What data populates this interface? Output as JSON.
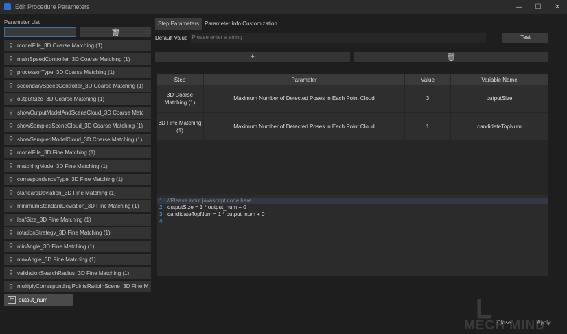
{
  "window": {
    "title": "Edit Procedure Parameters",
    "minimize": "—",
    "maximize": "☐",
    "close": "✕"
  },
  "left": {
    "label": "Parameter List",
    "add": "+",
    "delete": "🗑",
    "items": [
      "modelFile_3D Coarse Matching (1)",
      "mainSpeedController_3D Coarse Matching (1)",
      "processorType_3D Coarse Matching (1)",
      "secondarySpeedController_3D Coarse Matching (1)",
      "outputSize_3D Coarse Matching (1)",
      "showOutputModelAndSceneCloud_3D Coarse Matc",
      "showSampledSceneCloud_3D Coarse Matching (1)",
      "showSampledModelCloud_3D Coarse Matching (1)",
      "modelFile_3D Fine Matching (1)",
      "matchingMode_3D Fine Matching (1)",
      "correspondenceType_3D Fine Matching (1)",
      "standardDeviation_3D Fine Matching (1)",
      "minimumStandardDeviation_3D Fine Matching (1)",
      "leafSize_3D Fine Matching (1)",
      "rotationStrategy_3D Fine Matching (1)",
      "minAngle_3D Fine Matching (1)",
      "maxAngle_3D Fine Matching (1)",
      "validationSearchRadius_3D Fine Matching (1)",
      "multiplyCorrespondingPointsRatioInScene_3D Fine M"
    ],
    "selected": "output_num"
  },
  "right": {
    "tabs": [
      "Step Parameters",
      "Parameter Info Customization"
    ],
    "default_value_label": "Default Value",
    "default_value_placeholder": "Please enter a string",
    "test_button": "Test",
    "add": "+",
    "delete": "🗑",
    "table": {
      "headers": [
        "Step",
        "Parameter",
        "Value",
        "Variable Name"
      ],
      "rows": [
        {
          "step": "3D Coarse Matching (1)",
          "parameter": "Maximum Number of Detected Poses in Each Point Cloud",
          "value": "3",
          "variable": "outputSize"
        },
        {
          "step": "3D Fine Matching (1)",
          "parameter": "Maximum Number of Detected Poses in Each Point Cloud",
          "value": "1",
          "variable": "candidateTopNum"
        }
      ]
    },
    "code": [
      {
        "n": "1",
        "text": "//Please input javascript code here."
      },
      {
        "n": "2",
        "text": "outputSize = 1 * output_num + 0"
      },
      {
        "n": "3",
        "text": "candidateTopNum = 1 * output_num + 0"
      },
      {
        "n": "4",
        "text": ""
      }
    ]
  },
  "footer": {
    "close": "Close",
    "apply": "Apply",
    "logo_text": "MECH MIND"
  }
}
